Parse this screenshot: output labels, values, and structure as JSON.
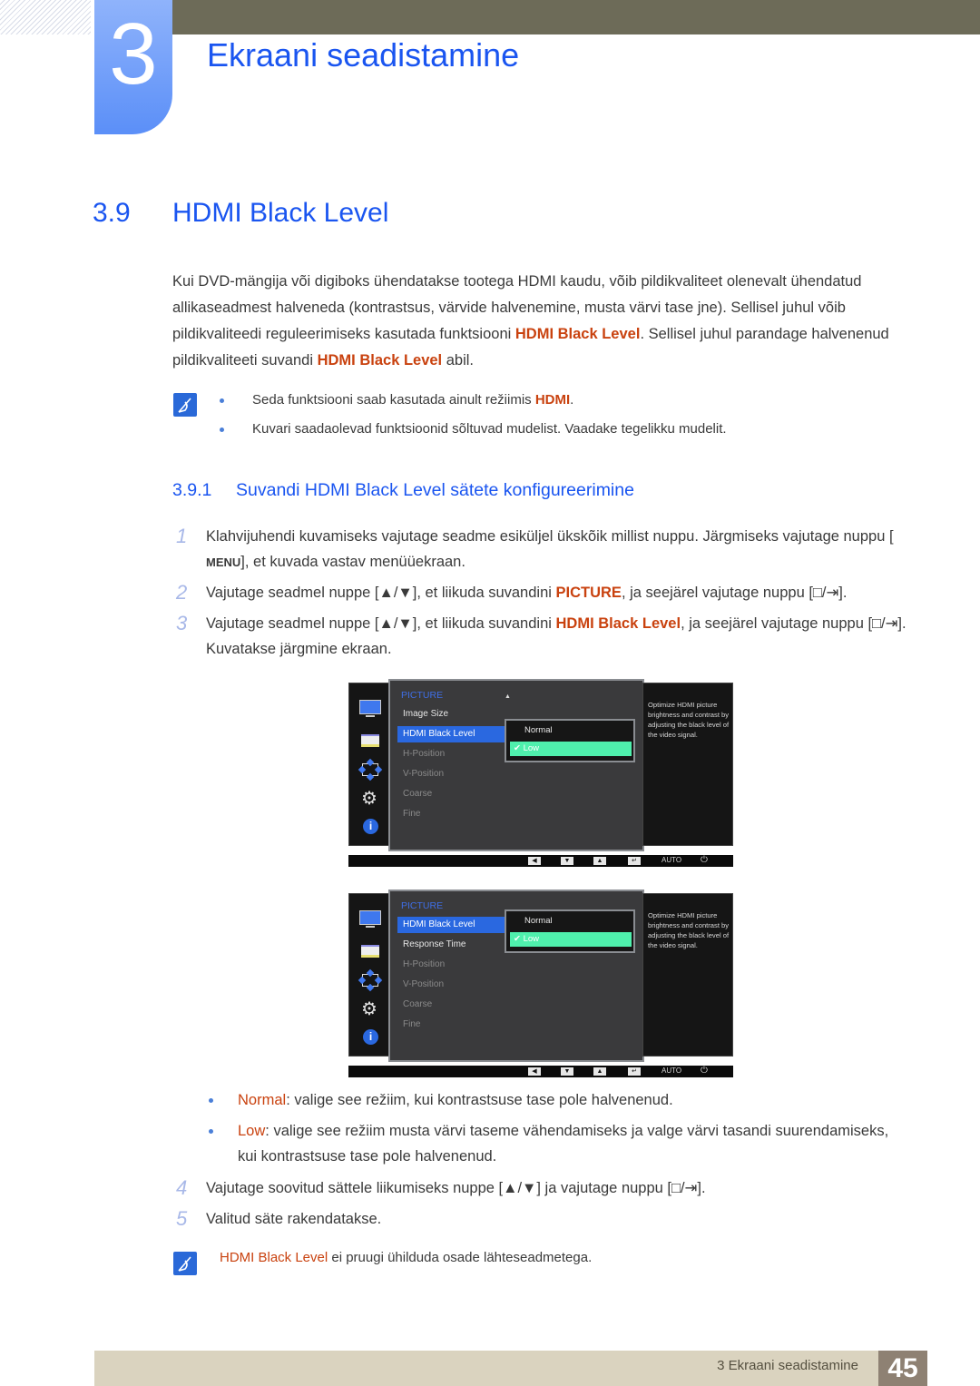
{
  "chapter": {
    "number": "3",
    "title": "Ekraani seadistamine"
  },
  "section": {
    "number": "3.9",
    "title": "HDMI Black Level"
  },
  "intro": {
    "p1": "Kui DVD-mängija või digiboks ühendatakse tootega HDMI kaudu, võib pildikvaliteet olenevalt ühendatud allikaseadmest halveneda (kontrastsus, värvide halvenemine, musta värvi tase jne). Sellisel juhul võib pildikvaliteedi reguleerimiseks kasutada funktsiooni ",
    "hl1": "HDMI Black Level",
    "p2": ". Sellisel juhul parandage halvenenud pildikvaliteeti suvandi ",
    "hl2": "HDMI Black Level",
    "p3": " abil."
  },
  "notes": [
    {
      "text": "Seda funktsiooni saab kasutada ainult režiimis ",
      "hl": "HDMI",
      "tail": "."
    },
    {
      "text": "Kuvari saadaolevad funktsioonid sõltuvad mudelist. Vaadake tegelikku mudelit."
    }
  ],
  "subsection": {
    "number": "3.9.1",
    "title": "Suvandi HDMI Black Level sätete konfigureerimine"
  },
  "steps": [
    {
      "n": "1",
      "a": "Klahvijuhendi kuvamiseks vajutage seadme esiküljel ükskõik millist nuppu. Järgmiseks vajutage nuppu [",
      "key": "MENU",
      "b": "], et kuvada vastav menüüekraan."
    },
    {
      "n": "2",
      "a": "Vajutage seadmel nuppe [▲/▼], et liikuda suvandini ",
      "hl": "PICTURE",
      "b": ", ja seejärel vajutage nuppu [□/⇥]."
    },
    {
      "n": "3",
      "a": "Vajutage seadmel nuppe [▲/▼], et liikuda suvandini ",
      "hl": "HDMI Black Level",
      "b": ", ja seejärel vajutage nuppu [□/⇥]. Kuvatakse järgmine ekraan."
    },
    {
      "n": "4",
      "a": "Vajutage soovitud sättele liikumiseks nuppe [▲/▼] ja vajutage nuppu [□/⇥]."
    },
    {
      "n": "5",
      "a": "Valitud säte rakendatakse."
    }
  ],
  "osd1": {
    "category": "PICTURE",
    "items": [
      "Image Size",
      "HDMI Black Level",
      "H-Position",
      "V-Position",
      "Coarse",
      "Fine"
    ],
    "selected_index": 1,
    "options": [
      "Normal",
      "Low"
    ],
    "selected_option": "Low",
    "description": "Optimize HDMI picture brightness and contrast by adjusting the black level of the video signal."
  },
  "osd2": {
    "category": "PICTURE",
    "items": [
      "HDMI Black Level",
      "Response Time",
      "H-Position",
      "V-Position",
      "Coarse",
      "Fine"
    ],
    "selected_index": 0,
    "options": [
      "Normal",
      "Low"
    ],
    "selected_option": "Low",
    "description": "Optimize HDMI picture brightness and contrast by adjusting the black level of the video signal."
  },
  "osd_bar": {
    "buttons": [
      "◀",
      "▼",
      "▲",
      "↵"
    ],
    "auto": "AUTO",
    "power": "⏻"
  },
  "osd_icons": [
    "monitor-icon",
    "color-bars-icon",
    "resize-icon",
    "gear-icon",
    "info-icon"
  ],
  "option_notes": [
    {
      "hl": "Normal",
      "text": ": valige see režiim, kui kontrastsuse tase pole halvenenud."
    },
    {
      "hl": "Low",
      "text": ": valige see režiim musta värvi taseme vähendamiseks ja valge värvi tasandi suurendamiseks, kui kontrastsuse tase pole halvenenud."
    }
  ],
  "final_note": {
    "hl": "HDMI Black Level",
    "text": " ei pruugi ühilduda osade lähteseadmetega."
  },
  "footer": {
    "text": "3 Ekraani seadistamine",
    "page": "45"
  },
  "colors": {
    "heading": "#1a55f0",
    "highlight": "#c9420f",
    "selection": "#2a68e0",
    "active_option": "#4ff0ad"
  }
}
